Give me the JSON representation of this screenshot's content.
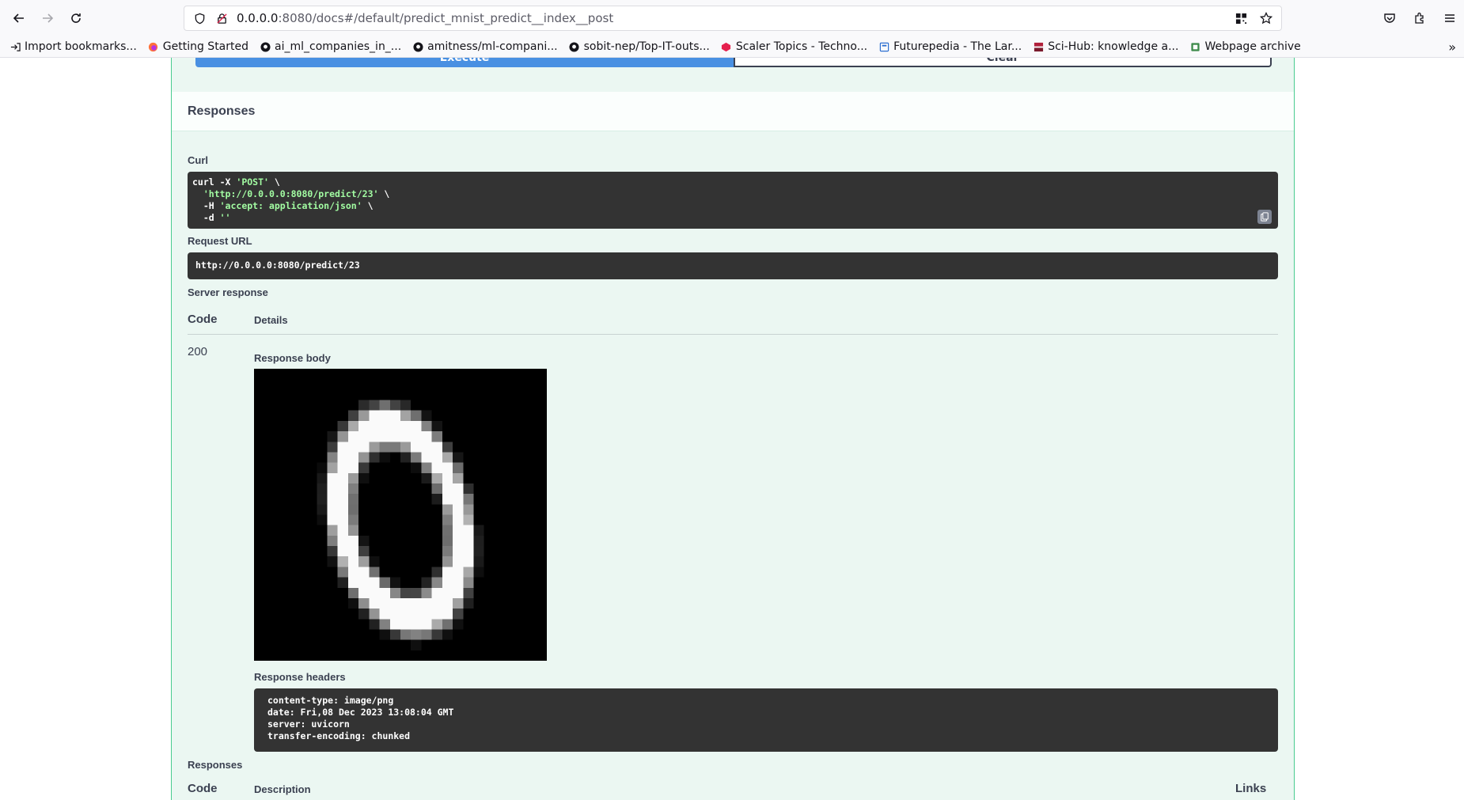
{
  "browser": {
    "url_host": "0.0.0.0",
    "url_rest": ":8080/docs#/default/predict_mnist_predict__index__post",
    "bookmarks": [
      {
        "label": "Import bookmarks...",
        "icon": "import-icon"
      },
      {
        "label": "Getting Started",
        "icon": "firefox-icon"
      },
      {
        "label": "ai_ml_companies_in_...",
        "icon": "github-icon"
      },
      {
        "label": "amitness/ml-compani...",
        "icon": "github-icon"
      },
      {
        "label": "sobit-nep/Top-IT-outs...",
        "icon": "github-icon"
      },
      {
        "label": "Scaler Topics - Techno...",
        "icon": "scaler-icon"
      },
      {
        "label": "Futurepedia - The Lar...",
        "icon": "futurepedia-icon"
      },
      {
        "label": "Sci-Hub: knowledge a...",
        "icon": "scihub-icon"
      },
      {
        "label": "Webpage archive",
        "icon": "archive-icon"
      }
    ]
  },
  "operation": {
    "execute_label": "Execute",
    "clear_label": "Clear"
  },
  "responses": {
    "title": "Responses",
    "curl_label": "Curl",
    "curl_lines": [
      {
        "plain": "curl -X ",
        "str": "'POST'",
        "tail": " \\"
      },
      {
        "plain": "  ",
        "str": "'http://0.0.0.0:8080/predict/23'",
        "tail": " \\"
      },
      {
        "plain": "  -H ",
        "str": "'accept: application/json'",
        "tail": " \\"
      },
      {
        "plain": "  -d ",
        "str": "''",
        "tail": ""
      }
    ],
    "request_url_label": "Request URL",
    "request_url": "http://0.0.0.0:8080/predict/23",
    "server_response_label": "Server response",
    "code_header": "Code",
    "details_header": "Details",
    "status_code": "200",
    "response_body_label": "Response body",
    "response_headers_label": "Response headers",
    "response_headers": [
      "content-type: image/png",
      "date: Fri,08 Dec 2023 13:08:04 GMT",
      "server: uvicorn",
      "transfer-encoding: chunked"
    ],
    "responses_label": "Responses",
    "bottom_code_header": "Code",
    "description_header": "Description",
    "links_header": "Links"
  },
  "colors": {
    "block_bg": "#ebf7f2",
    "block_border": "#49cc90",
    "execute_blue": "#4990e2",
    "code_bg": "#333333",
    "string_green": "#a2fca2"
  }
}
